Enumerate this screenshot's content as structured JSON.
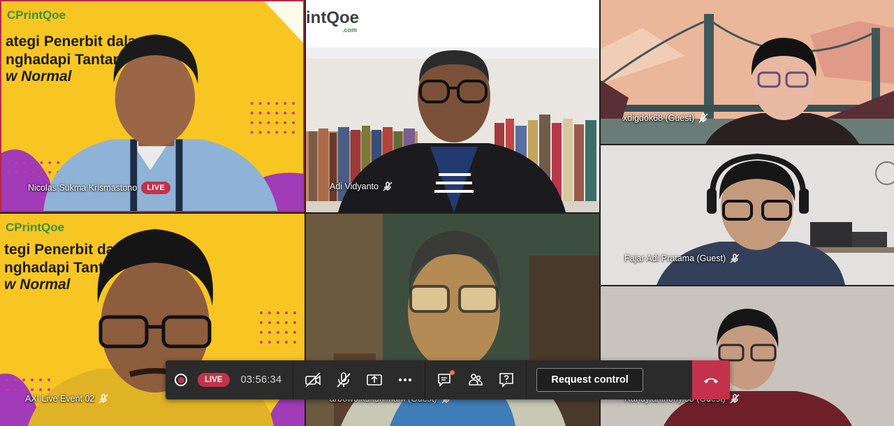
{
  "tiles": [
    {
      "name": "Nicolas Sukma Krismastono",
      "live": "LIVE",
      "logo": "CPrintQoe",
      "slide_lines": [
        "ategi Penerbit dalam",
        "nghadapi Tantan",
        "w Normal"
      ]
    },
    {
      "name": "Adi Vidyanto",
      "muted": true,
      "logo": "intQoe",
      "logo_sub": ".com"
    },
    {
      "name": "xdigdok68 (Guest)",
      "muted": true
    },
    {
      "name": "AXI Live Event 02",
      "muted": true,
      "logo": "CPrintQoe",
      "slide_lines": [
        "tegi Penerbit da",
        "nghadapi Tantan",
        "w Normal"
      ]
    },
    {
      "name": "arbowo.kukuhimam (Guest)",
      "muted": true
    },
    {
      "name": "Fajar Adi Pratama (Guest)",
      "muted": true
    },
    {
      "name": "Randy.anthony.68 (Guest)",
      "muted": true
    }
  ],
  "toolbar": {
    "live_label": "LIVE",
    "timer": "03:56:34",
    "request_control_label": "Request control",
    "icons": [
      "record-icon",
      "camera-off-icon",
      "mic-off-icon",
      "share-screen-icon",
      "more-options-icon",
      "chat-icon",
      "participants-icon",
      "qa-icon",
      "hang-up-icon"
    ]
  },
  "colors": {
    "live_red": "#c4314b",
    "toolbar_bg": "#2b2b2b",
    "slide_yellow": "#f7c623"
  }
}
